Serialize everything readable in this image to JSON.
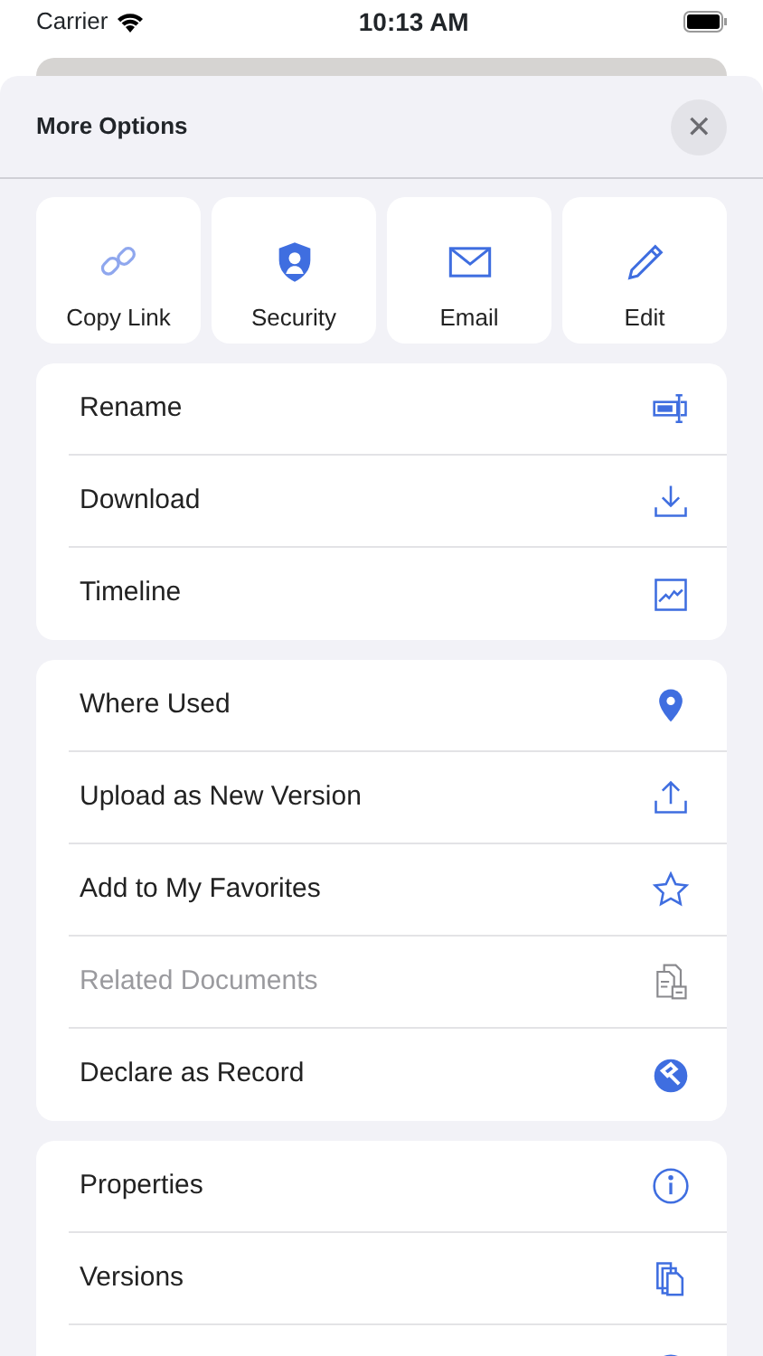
{
  "status_bar": {
    "carrier": "Carrier",
    "time": "10:13 AM"
  },
  "sheet": {
    "title": "More Options",
    "close": "✕"
  },
  "quick_actions": [
    {
      "label": "Copy Link"
    },
    {
      "label": "Security"
    },
    {
      "label": "Email"
    },
    {
      "label": "Edit"
    }
  ],
  "groups": [
    {
      "items": [
        {
          "label": "Rename",
          "disabled": false
        },
        {
          "label": "Download",
          "disabled": false
        },
        {
          "label": "Timeline",
          "disabled": false
        }
      ]
    },
    {
      "items": [
        {
          "label": "Where Used",
          "disabled": false
        },
        {
          "label": "Upload as New Version",
          "disabled": false
        },
        {
          "label": "Add to My Favorites",
          "disabled": false
        },
        {
          "label": "Related Documents",
          "disabled": true
        },
        {
          "label": "Declare as Record",
          "disabled": false
        }
      ]
    },
    {
      "items": [
        {
          "label": "Properties",
          "disabled": false
        },
        {
          "label": "Versions",
          "disabled": false
        }
      ],
      "more_below": true
    }
  ]
}
